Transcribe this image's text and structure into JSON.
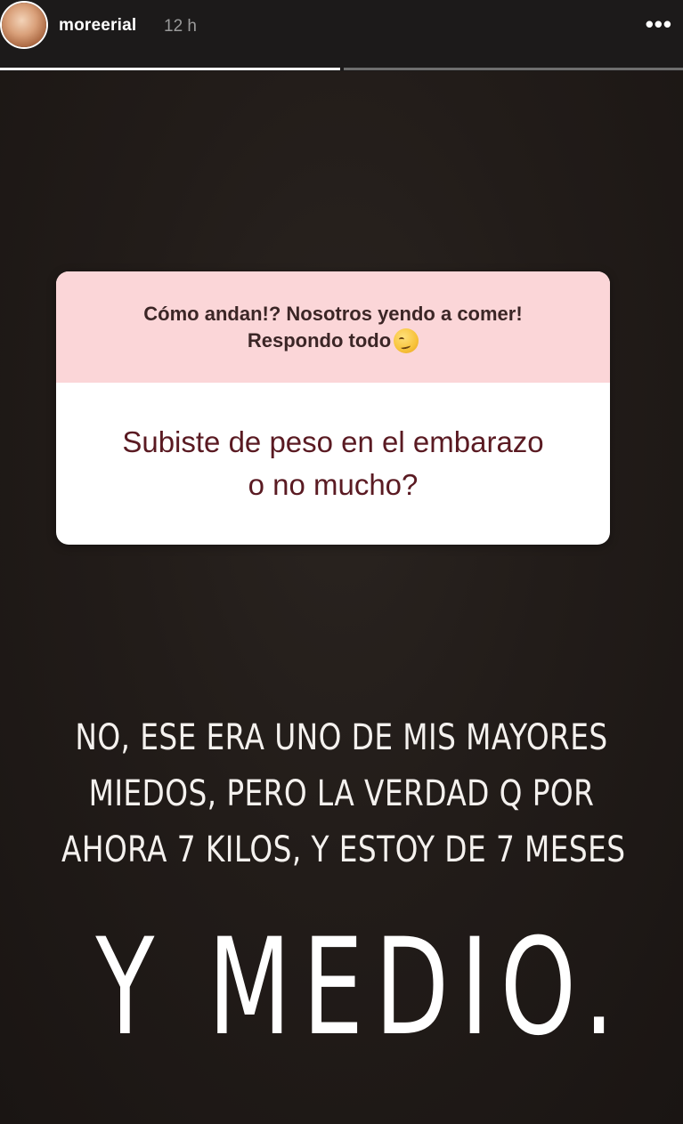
{
  "header": {
    "username": "moreerial",
    "time": "12 h",
    "more_icon": "more-horizontal-icon",
    "progress": {
      "segments": 2,
      "active_index": 0
    }
  },
  "sticker": {
    "prompt_line1": "Cómo andan!? Nosotros yendo a comer!",
    "prompt_line2": "Respondo todo",
    "emoji": "smirking-face-emoji",
    "question_line1": "Subiste de peso en el embarazo",
    "question_line2": "o no mucho?",
    "top_color": "#fbd6d8",
    "question_color": "#5a1a22"
  },
  "caption": {
    "line1": "NO, ESE ERA UNO DE MIS MAYORES",
    "line2": "MIEDOS, PERO LA VERDAD Q POR",
    "line3": "AHORA 7 KILOS, Y ESTOY DE 7 MESES",
    "big": "Y MEDIO."
  }
}
